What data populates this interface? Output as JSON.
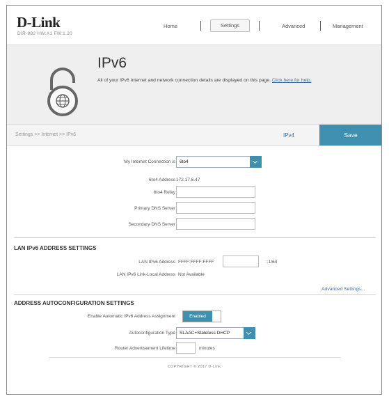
{
  "header": {
    "logo": "D-Link",
    "model": "DIR-882   HW:A1   FW:1.20",
    "nav": {
      "home": "Home",
      "settings": "Settings",
      "advanced": "Advanced",
      "management": "Management"
    }
  },
  "banner": {
    "title": "IPv6",
    "description": "All of your IPv6 Internet and network connection details are displayed on this page.",
    "help_link": "Click here for help."
  },
  "crumbbar": {
    "breadcrumb": "Settings >> Internet >> IPv6",
    "ipv4_link": "IPv4",
    "save_label": "Save"
  },
  "connection": {
    "label": "My Internet Connection is",
    "value": "6to4"
  },
  "fields": {
    "ipv6_address_label": "6to4 Address",
    "ipv6_address_value": "172.17.6.47",
    "relay_label": "6to4 Relay",
    "relay_value": "",
    "primary_dns_label": "Primary DNS Server",
    "primary_dns_value": "",
    "secondary_dns_label": "Secondary DNS Server",
    "secondary_dns_value": ""
  },
  "lan": {
    "section_title": "LAN IPv6 ADDRESS SETTINGS",
    "lan_address_label": "LAN IPv6 Address",
    "lan_address_prefix": "FFFF:FFFF:FFFF",
    "lan_address_input": "",
    "lan_address_suffix": "::1/64",
    "link_local_label": "LAN IPv6 Link-Local Address",
    "link_local_value": "Not Available",
    "advanced_link": "Advanced Settings..."
  },
  "autoconfig": {
    "section_title": "ADDRESS AUTOCONFIGURATION SETTINGS",
    "enable_label": "Enable Automatic IPv6 Address Assignment",
    "enable_value": "Enabled",
    "type_label": "Autoconfiguration Type",
    "type_value": "SLAAC+Stateless DHCP",
    "lifetime_label": "Router Advertisement Lifetime",
    "lifetime_value": "",
    "lifetime_unit": "minutes"
  },
  "footer": {
    "copyright": "COPYRIGHT © 2017 D-Link"
  },
  "colors": {
    "accent": "#3f8fb0",
    "link": "#3a6fa8",
    "banner_bg": "#efefef"
  }
}
